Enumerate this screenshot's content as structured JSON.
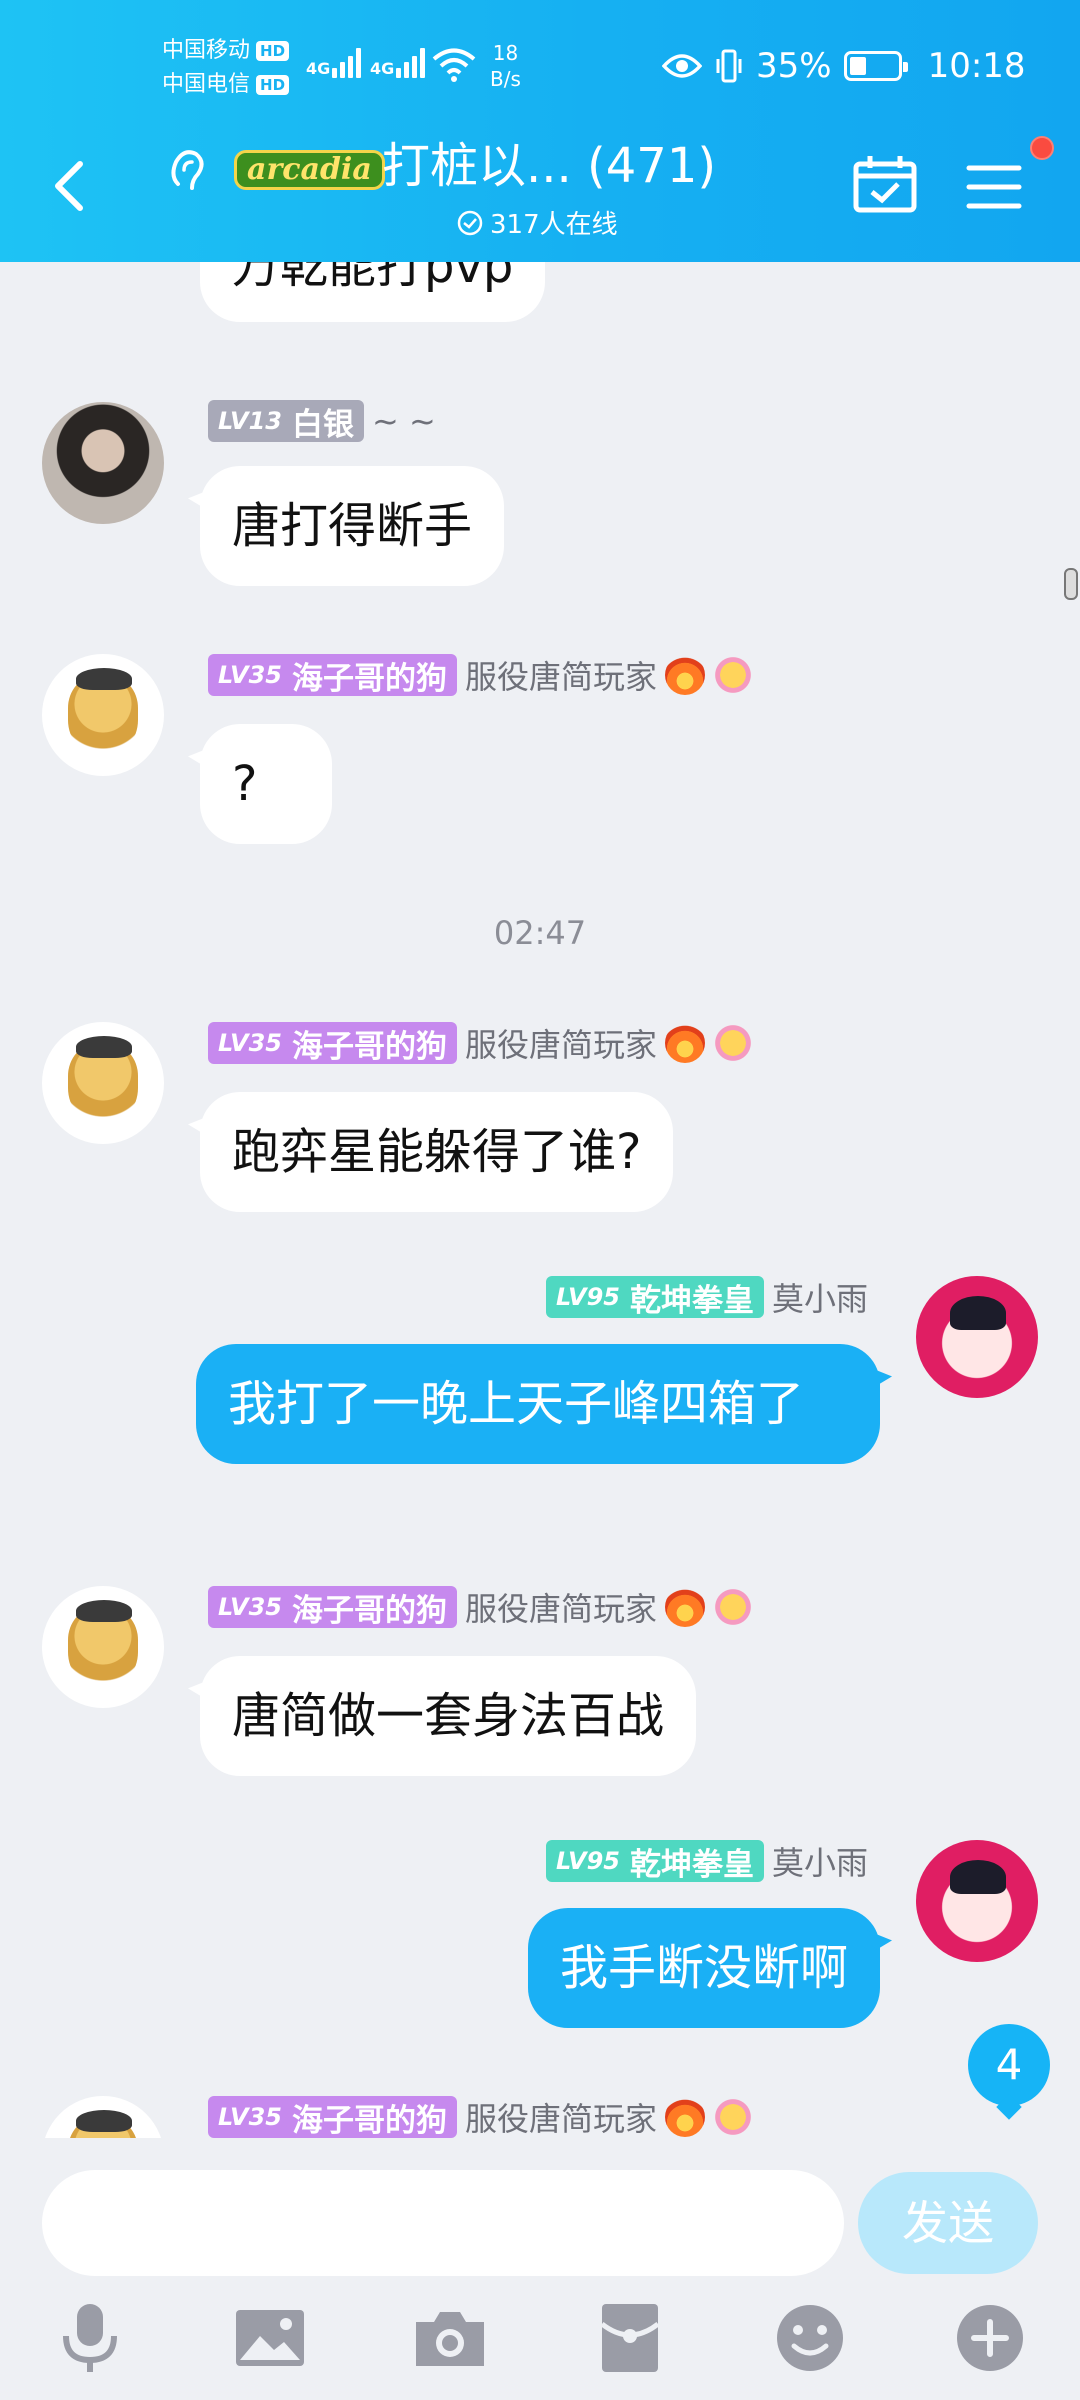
{
  "status_bar": {
    "carrier1": "中国移动",
    "carrier2": "中国电信",
    "hd_label": "HD",
    "net1": "4G",
    "net2": "4G",
    "speed_value": "18",
    "speed_unit": "B/s",
    "battery_percent": "35%",
    "battery_level": 0.35,
    "time": "10:18"
  },
  "header": {
    "logo_text": "arcadia",
    "title": "打桩以... (471)",
    "online": "317人在线",
    "has_notification_dot": true
  },
  "chat": {
    "top_partial_text": "万乾能打pvp",
    "timestamp": "02:47",
    "messages": [
      {
        "level": "LV13",
        "badge": "白银",
        "title": "~ ~",
        "text": "唐打得断手"
      },
      {
        "level": "LV35",
        "badge": "海子哥的狗",
        "title": "服役唐简玩家",
        "text": "?"
      },
      {
        "level": "LV35",
        "badge": "海子哥的狗",
        "title": "服役唐简玩家",
        "text": "跑弈星能躲得了谁?"
      },
      {
        "level": "LV95",
        "badge": "乾坤拳皇",
        "title": "莫小雨",
        "text": "我打了一晚上天子峰四箱了"
      },
      {
        "level": "LV35",
        "badge": "海子哥的狗",
        "title": "服役唐简玩家",
        "text": "唐简做一套身法百战"
      },
      {
        "level": "LV95",
        "badge": "乾坤拳皇",
        "title": "莫小雨",
        "text": "我手断没断啊"
      },
      {
        "level": "LV35",
        "badge": "海子哥的狗",
        "title": "服役唐简玩家",
        "text": ""
      }
    ],
    "unread_count": "4"
  },
  "input": {
    "placeholder": "",
    "send_label": "发送"
  },
  "toolbar": {
    "items": [
      "mic-icon",
      "image-icon",
      "camera-icon",
      "red-packet-icon",
      "emoji-icon",
      "plus-icon"
    ]
  },
  "colors": {
    "header_gradient_start": "#1ec3f4",
    "header_gradient_end": "#12a6f0",
    "my_bubble": "#1ab0f5",
    "badge_silver": "#a8a9b8",
    "badge_purple": "#c689ee",
    "badge_teal": "#4fd8c1",
    "send_disabled": "#b8e8fb"
  }
}
